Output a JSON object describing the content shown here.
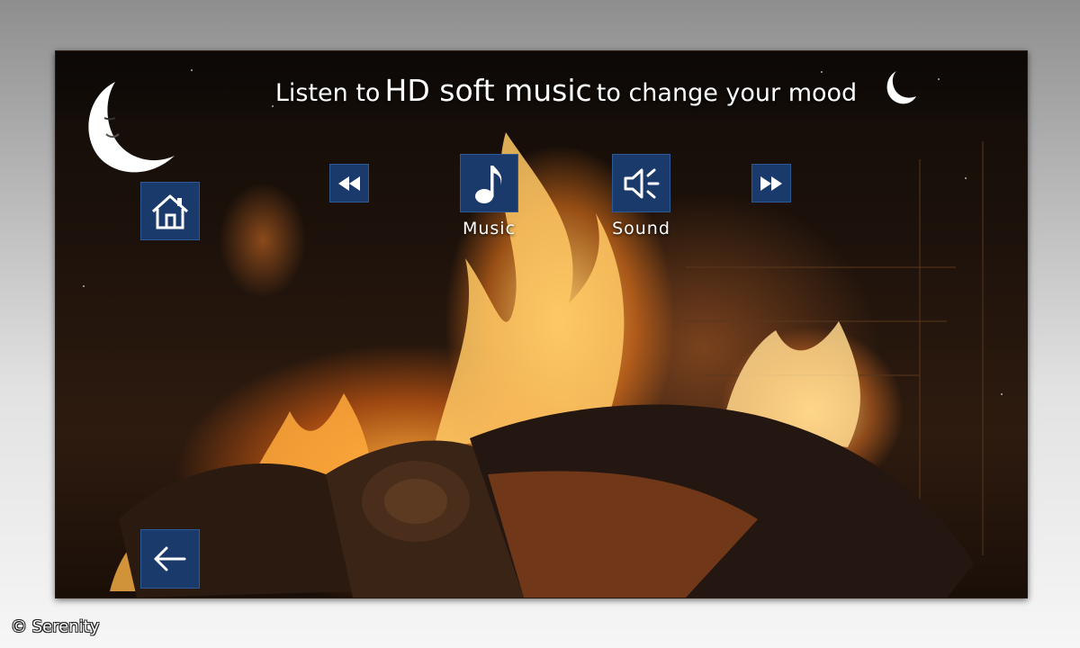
{
  "headline": {
    "part1": "Listen to",
    "part2": "HD soft music",
    "part3": "to change your mood"
  },
  "controls": {
    "music_label": "Music",
    "sound_label": "Sound"
  },
  "icons": {
    "logo": "crescent-moon-face-icon",
    "headline_end": "crescent-moon-icon",
    "home": "home-icon",
    "rewind": "rewind-icon",
    "music": "music-note-icon",
    "sound": "speaker-icon",
    "fast_forward": "fast-forward-icon",
    "back": "back-arrow-icon"
  },
  "colors": {
    "tile": "#1a3a6b",
    "text": "#ffffff",
    "fire": "#ff9a2a"
  },
  "watermark": "© Serenity"
}
